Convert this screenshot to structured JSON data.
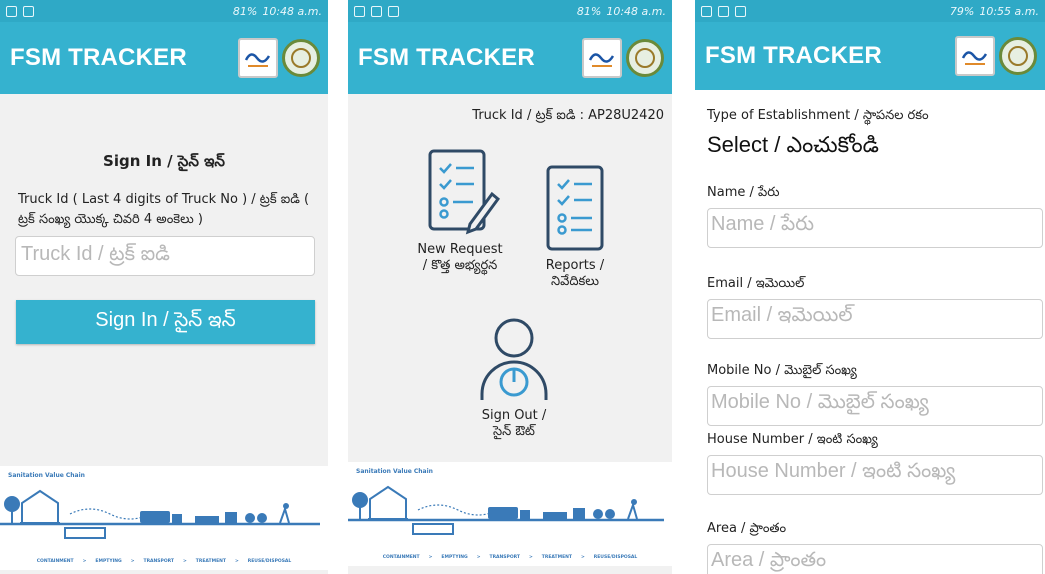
{
  "colors": {
    "accent": "#35b2cf",
    "statusbar": "#2fa9c6"
  },
  "app_title": "FSM TRACKER",
  "screens": [
    {
      "status_time": "10:48 a.m.",
      "status_battery": "81%",
      "signin_title": "Sign In / సైన్ ఇన్",
      "truck_label": "Truck Id ( Last 4 digits of Truck No ) / ట్రక్ ఐడి ( ట్రక్ సంఖ్య యొక్క చివరి 4 అంకెలు )",
      "truck_placeholder": "Truck Id / ట్రక్ ఐడి",
      "signin_button": "Sign In / సైన్ ఇన్"
    },
    {
      "status_time": "10:48 a.m.",
      "status_battery": "81%",
      "truck_id": "Truck Id / ట్రక్ ఐడి : AP28U2420",
      "new_request": "New Request / కొత్త అభ్యర్థన",
      "reports": "Reports / నివేదికలు",
      "sign_out": "Sign Out / సైన్ ఔట్"
    },
    {
      "status_time": "10:55 a.m.",
      "status_battery": "79%",
      "establishment_label": "Type of Establishment / స్థాపనల రకం",
      "establishment_value": "Select / ఎంచుకోండి",
      "name_label": "Name / పేరు",
      "name_placeholder": "Name / పేరు",
      "email_label": "Email / ఇమెయిల్",
      "email_placeholder": "Email / ఇమెయిల్",
      "mobile_label": "Mobile No / మొబైల్ సంఖ్య",
      "mobile_placeholder": "Mobile No / మొబైల్ సంఖ్య",
      "house_label": "House Number / ఇంటి సంఖ్య",
      "house_placeholder": "House Number / ఇంటి సంఖ్య",
      "area_label": "Area / ప్రాంతం",
      "area_placeholder": "Area / ప్రాంతం"
    }
  ],
  "chain": {
    "title": "Sanitation Value Chain",
    "steps": [
      "CONTAINMENT",
      ">",
      "EMPTYING",
      ">",
      "TRANSPORT",
      ">",
      "TREATMENT",
      ">",
      "REUSE/DISPOSAL"
    ]
  },
  "icons": [
    "new-request-document-icon",
    "reports-document-icon",
    "sign-out-user-icon"
  ]
}
